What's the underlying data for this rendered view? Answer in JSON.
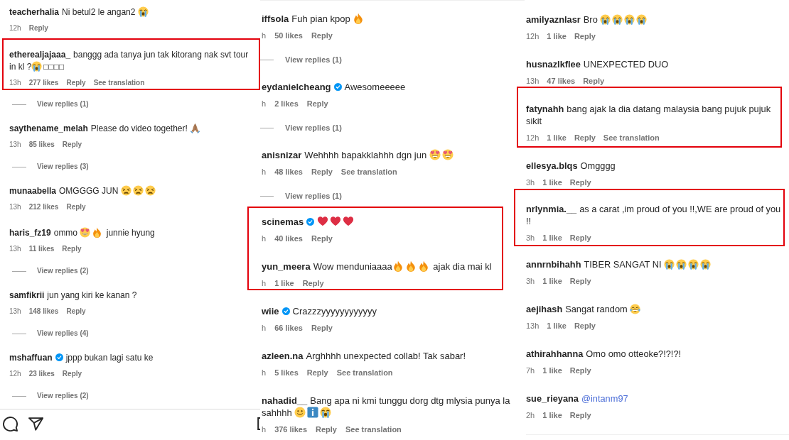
{
  "panels": [
    {
      "items": [
        {
          "kind": "comment",
          "username": "teacherhalia",
          "verified": false,
          "body": [
            {
              "kind": "text",
              "text": "Ni betul2 le angan2 "
            },
            {
              "kind": "crying"
            }
          ],
          "time": "12h",
          "reply": "Reply"
        },
        {
          "kind": "highlight",
          "items": [
            {
              "kind": "comment",
              "username": "etherealjajaaa_",
              "verified": false,
              "body": [
                {
                  "kind": "text",
                  "text": "banggg ada tanya jun tak kitorang nak svt tour in kl ?"
                },
                {
                  "kind": "crying"
                },
                {
                  "kind": "text",
                  "text": "□□□□"
                }
              ],
              "time": "13h",
              "likes": "277 likes",
              "reply": "Reply",
              "translation": "See translation"
            }
          ]
        },
        {
          "kind": "replies",
          "label": "View replies (1)"
        },
        {
          "kind": "comment",
          "username": "saythename_melah",
          "verified": false,
          "body": [
            {
              "kind": "text",
              "text": "Please do video together! "
            },
            {
              "kind": "pray"
            }
          ],
          "time": "13h",
          "likes": "85 likes",
          "reply": "Reply"
        },
        {
          "kind": "replies",
          "label": "View replies (3)"
        },
        {
          "kind": "comment",
          "username": "munaabella",
          "verified": false,
          "body": [
            {
              "kind": "text",
              "text": "OMGGGG JUN "
            },
            {
              "kind": "weary"
            },
            {
              "kind": "weary"
            },
            {
              "kind": "weary"
            }
          ],
          "time": "13h",
          "likes": "212 likes",
          "reply": "Reply"
        },
        {
          "kind": "comment",
          "username": "haris_fz19",
          "verified": false,
          "body": [
            {
              "kind": "text",
              "text": "ommo "
            },
            {
              "kind": "hearteyes"
            },
            {
              "kind": "fire"
            },
            {
              "kind": "text",
              "text": " junnie hyung"
            }
          ],
          "time": "13h",
          "likes": "11 likes",
          "reply": "Reply"
        },
        {
          "kind": "replies",
          "label": "View replies (2)"
        },
        {
          "kind": "comment",
          "username": "samfikrii",
          "verified": false,
          "body": [
            {
              "kind": "text",
              "text": "jun yang kiri ke kanan ?"
            }
          ],
          "time": "13h",
          "likes": "148 likes",
          "reply": "Reply"
        },
        {
          "kind": "replies",
          "label": "View replies (4)"
        },
        {
          "kind": "comment",
          "username": "mshaffuan",
          "verified": true,
          "body": [
            {
              "kind": "text",
              "text": "jppp bukan lagi satu ke"
            }
          ],
          "time": "12h",
          "likes": "23 likes",
          "reply": "Reply"
        },
        {
          "kind": "replies",
          "label": "View replies (2)"
        }
      ],
      "action_bar": true
    },
    {
      "items": [
        {
          "kind": "comment",
          "username": "iffsola",
          "verified": false,
          "body": [
            {
              "kind": "text",
              "text": "Fuh pian kpop "
            },
            {
              "kind": "fire"
            }
          ],
          "time": "h",
          "likes": "50 likes",
          "reply": "Reply"
        },
        {
          "kind": "replies",
          "label": "View replies (1)"
        },
        {
          "kind": "comment",
          "username": "eydanielcheang",
          "verified": true,
          "body": [
            {
              "kind": "text",
              "text": "Awesomeeeee"
            }
          ],
          "time": "h",
          "likes": "2 likes",
          "reply": "Reply"
        },
        {
          "kind": "replies",
          "label": "View replies (1)"
        },
        {
          "kind": "comment",
          "username": "anisnizar",
          "verified": false,
          "body": [
            {
              "kind": "text",
              "text": "Wehhhh bapakklahhh dgn jun "
            },
            {
              "kind": "hearteyes"
            },
            {
              "kind": "hearteyes"
            }
          ],
          "time": "h",
          "likes": "48 likes",
          "reply": "Reply",
          "translation": "See translation"
        },
        {
          "kind": "replies",
          "label": "View replies (1)"
        },
        {
          "kind": "highlight",
          "items": [
            {
              "kind": "comment",
              "username": "scinemas",
              "verified": true,
              "body": [
                {
                  "kind": "heart"
                },
                {
                  "kind": "heart"
                },
                {
                  "kind": "heart"
                }
              ],
              "time": "h",
              "likes": "40 likes",
              "reply": "Reply"
            },
            {
              "kind": "comment",
              "username": "yun_meera",
              "verified": false,
              "body": [
                {
                  "kind": "text",
                  "text": "Wow menduniaaaa"
                },
                {
                  "kind": "fire"
                },
                {
                  "kind": "fire"
                },
                {
                  "kind": "fire"
                },
                {
                  "kind": "text",
                  "text": " ajak dia mai kl"
                }
              ],
              "time": "h",
              "likes": "1 like",
              "reply": "Reply"
            }
          ]
        },
        {
          "kind": "comment",
          "username": "wiie",
          "verified": true,
          "body": [
            {
              "kind": "text",
              "text": "Crazzzyyyyyyyyyyyy"
            }
          ],
          "time": "h",
          "likes": "66 likes",
          "reply": "Reply"
        },
        {
          "kind": "comment",
          "username": "azleen.na",
          "verified": false,
          "body": [
            {
              "kind": "text",
              "text": "Arghhhh unexpected collab! Tak sabar!"
            }
          ],
          "time": "h",
          "likes": "5 likes",
          "reply": "Reply",
          "translation": "See translation"
        },
        {
          "kind": "comment",
          "username": "nahadid__",
          "verified": false,
          "body": [
            {
              "kind": "text",
              "text": "Bang apa ni kmi tunggu dorg dtg mlysia punya la sahhhh "
            },
            {
              "kind": "smile"
            },
            {
              "kind": "info"
            },
            {
              "kind": "crying"
            }
          ],
          "time": "h",
          "likes": "376 likes",
          "reply": "Reply",
          "translation": "See translation"
        }
      ]
    },
    {
      "items": [
        {
          "kind": "comment",
          "username": "amilyaznlasr",
          "verified": false,
          "body": [
            {
              "kind": "text",
              "text": "Bro "
            },
            {
              "kind": "crying"
            },
            {
              "kind": "crying"
            },
            {
              "kind": "crying"
            },
            {
              "kind": "crying"
            }
          ],
          "time": "12h",
          "likes": "1 like",
          "reply": "Reply"
        },
        {
          "kind": "comment",
          "username": "husnazlkflee",
          "verified": false,
          "body": [
            {
              "kind": "text",
              "text": "UNEXPECTED DUO"
            }
          ],
          "time": "13h",
          "likes": "47 likes",
          "reply": "Reply"
        },
        {
          "kind": "highlight",
          "items": [
            {
              "kind": "comment",
              "username": "fatynahh",
              "verified": false,
              "body": [
                {
                  "kind": "text",
                  "text": "bang ajak la dia datang malaysia bang pujuk pujuk sikit"
                }
              ],
              "time": "12h",
              "likes": "1 like",
              "reply": "Reply",
              "translation": "See translation"
            }
          ]
        },
        {
          "kind": "comment",
          "username": "ellesya.blqs",
          "verified": false,
          "body": [
            {
              "kind": "text",
              "text": "Omgggg"
            }
          ],
          "time": "3h",
          "likes": "1 like",
          "reply": "Reply"
        },
        {
          "kind": "highlight",
          "items": [
            {
              "kind": "comment",
              "username": "nrlynmia.__",
              "verified": false,
              "body": [
                {
                  "kind": "text",
                  "text": "as a carat ,im proud of you !!,WE are proud of you !!"
                }
              ],
              "time": "3h",
              "likes": "1 like",
              "reply": "Reply"
            }
          ]
        },
        {
          "kind": "comment",
          "username": "annrnbihahh",
          "verified": false,
          "body": [
            {
              "kind": "text",
              "text": "TIBER SANGAT NI "
            },
            {
              "kind": "crying"
            },
            {
              "kind": "crying"
            },
            {
              "kind": "crying"
            },
            {
              "kind": "crying"
            }
          ],
          "time": "3h",
          "likes": "1 like",
          "reply": "Reply"
        },
        {
          "kind": "comment",
          "username": "aejihash",
          "verified": false,
          "body": [
            {
              "kind": "text",
              "text": "Sangat random "
            },
            {
              "kind": "joy"
            }
          ],
          "time": "13h",
          "likes": "1 like",
          "reply": "Reply"
        },
        {
          "kind": "comment",
          "username": "athirahhanna",
          "verified": false,
          "body": [
            {
              "kind": "text",
              "text": "Omo omo otteoke?!?!?!"
            }
          ],
          "time": "7h",
          "likes": "1 like",
          "reply": "Reply"
        },
        {
          "kind": "comment",
          "username": "sue_rieyana",
          "verified": false,
          "body": [
            {
              "kind": "mention",
              "text": "@intanm97"
            }
          ],
          "time": "2h",
          "likes": "1 like",
          "reply": "Reply"
        }
      ]
    }
  ]
}
